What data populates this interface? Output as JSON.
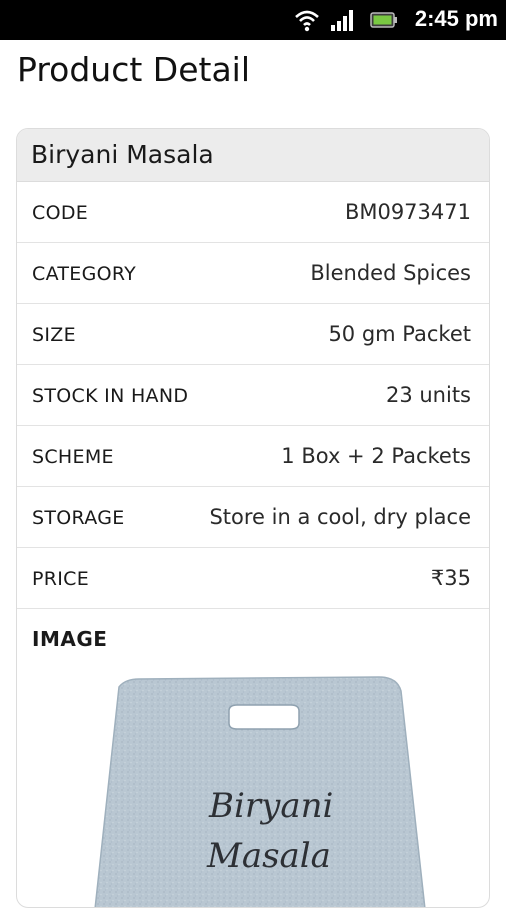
{
  "status_bar": {
    "time": "2:45 pm",
    "icons": [
      "wifi-icon",
      "signal-icon",
      "battery-icon"
    ]
  },
  "page": {
    "title": "Product Detail"
  },
  "product": {
    "name": "Biryani Masala",
    "fields": [
      {
        "label": "CODE",
        "value": "BM0973471"
      },
      {
        "label": "CATEGORY",
        "value": "Blended Spices"
      },
      {
        "label": "SIZE",
        "value": "50 gm Packet"
      },
      {
        "label": "STOCK IN HAND",
        "value": "23 units"
      },
      {
        "label": "SCHEME",
        "value": "1 Box + 2 Packets"
      },
      {
        "label": "STORAGE",
        "value": "Store in a cool, dry place"
      },
      {
        "label": "PRICE",
        "value": "₹35"
      }
    ],
    "image_label": "IMAGE",
    "image_text": [
      "Biryani",
      "Masala"
    ]
  },
  "colors": {
    "status_bar": "#000000",
    "header_bg": "#ececec",
    "border": "#dcdcdc",
    "package": "#b9c7d2"
  }
}
